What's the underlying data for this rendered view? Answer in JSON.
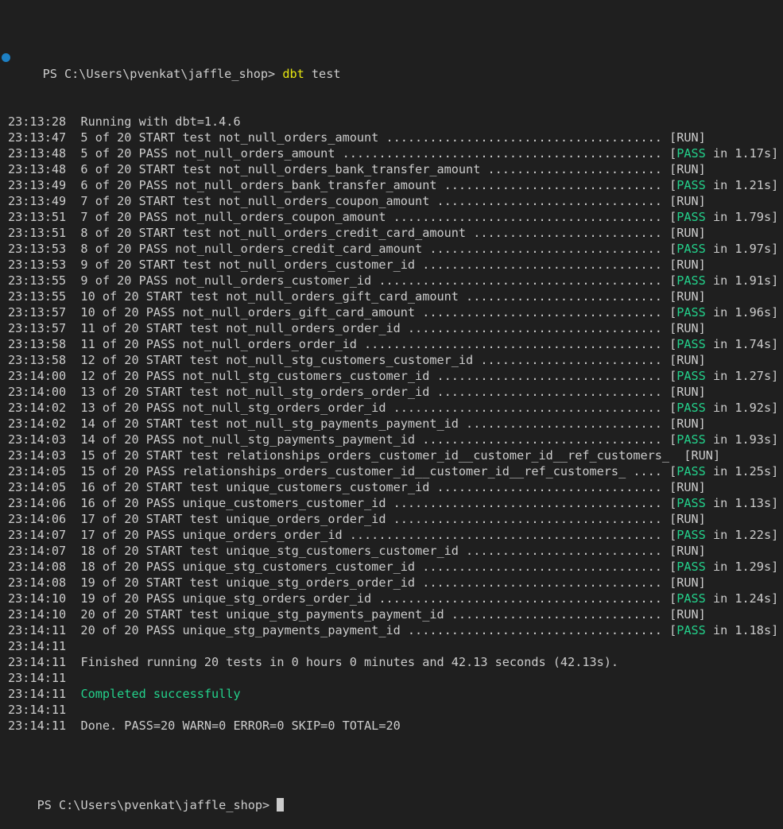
{
  "colors": {
    "bg": "#1f1f1f",
    "fg": "#cccccc",
    "green": "#23d18b",
    "yellow": "#e5e510",
    "dot": "#1d80c4",
    "cursor": "#cccccc"
  },
  "prompt": {
    "text": "PS C:\\Users\\pvenkat\\jaffle_shop> ",
    "command": "dbt",
    "args": " test"
  },
  "log_lines": [
    {
      "ts": "23:13:28",
      "msg": "Running with dbt=1.4.6"
    },
    {
      "ts": "23:13:47",
      "idx": "5 of 20",
      "verb": "START test",
      "name": "not_null_orders_amount",
      "dots": 38,
      "status": "RUN"
    },
    {
      "ts": "23:13:48",
      "idx": "5 of 20",
      "verb": "PASS",
      "name": "not_null_orders_amount",
      "dots": 44,
      "status": "PASS",
      "dur": "1.17s"
    },
    {
      "ts": "23:13:48",
      "idx": "6 of 20",
      "verb": "START test",
      "name": "not_null_orders_bank_transfer_amount",
      "dots": 24,
      "status": "RUN"
    },
    {
      "ts": "23:13:49",
      "idx": "6 of 20",
      "verb": "PASS",
      "name": "not_null_orders_bank_transfer_amount",
      "dots": 30,
      "status": "PASS",
      "dur": "1.21s"
    },
    {
      "ts": "23:13:49",
      "idx": "7 of 20",
      "verb": "START test",
      "name": "not_null_orders_coupon_amount",
      "dots": 31,
      "status": "RUN"
    },
    {
      "ts": "23:13:51",
      "idx": "7 of 20",
      "verb": "PASS",
      "name": "not_null_orders_coupon_amount",
      "dots": 37,
      "status": "PASS",
      "dur": "1.79s"
    },
    {
      "ts": "23:13:51",
      "idx": "8 of 20",
      "verb": "START test",
      "name": "not_null_orders_credit_card_amount",
      "dots": 26,
      "status": "RUN"
    },
    {
      "ts": "23:13:53",
      "idx": "8 of 20",
      "verb": "PASS",
      "name": "not_null_orders_credit_card_amount",
      "dots": 32,
      "status": "PASS",
      "dur": "1.97s"
    },
    {
      "ts": "23:13:53",
      "idx": "9 of 20",
      "verb": "START test",
      "name": "not_null_orders_customer_id",
      "dots": 33,
      "status": "RUN"
    },
    {
      "ts": "23:13:55",
      "idx": "9 of 20",
      "verb": "PASS",
      "name": "not_null_orders_customer_id",
      "dots": 39,
      "status": "PASS",
      "dur": "1.91s"
    },
    {
      "ts": "23:13:55",
      "idx": "10 of 20",
      "verb": "START test",
      "name": "not_null_orders_gift_card_amount",
      "dots": 27,
      "status": "RUN"
    },
    {
      "ts": "23:13:57",
      "idx": "10 of 20",
      "verb": "PASS",
      "name": "not_null_orders_gift_card_amount",
      "dots": 33,
      "status": "PASS",
      "dur": "1.96s"
    },
    {
      "ts": "23:13:57",
      "idx": "11 of 20",
      "verb": "START test",
      "name": "not_null_orders_order_id",
      "dots": 35,
      "status": "RUN"
    },
    {
      "ts": "23:13:58",
      "idx": "11 of 20",
      "verb": "PASS",
      "name": "not_null_orders_order_id",
      "dots": 41,
      "status": "PASS",
      "dur": "1.74s"
    },
    {
      "ts": "23:13:58",
      "idx": "12 of 20",
      "verb": "START test",
      "name": "not_null_stg_customers_customer_id",
      "dots": 25,
      "status": "RUN"
    },
    {
      "ts": "23:14:00",
      "idx": "12 of 20",
      "verb": "PASS",
      "name": "not_null_stg_customers_customer_id",
      "dots": 31,
      "status": "PASS",
      "dur": "1.27s"
    },
    {
      "ts": "23:14:00",
      "idx": "13 of 20",
      "verb": "START test",
      "name": "not_null_stg_orders_order_id",
      "dots": 31,
      "status": "RUN"
    },
    {
      "ts": "23:14:02",
      "idx": "13 of 20",
      "verb": "PASS",
      "name": "not_null_stg_orders_order_id",
      "dots": 37,
      "status": "PASS",
      "dur": "1.92s"
    },
    {
      "ts": "23:14:02",
      "idx": "14 of 20",
      "verb": "START test",
      "name": "not_null_stg_payments_payment_id",
      "dots": 27,
      "status": "RUN"
    },
    {
      "ts": "23:14:03",
      "idx": "14 of 20",
      "verb": "PASS",
      "name": "not_null_stg_payments_payment_id",
      "dots": 33,
      "status": "PASS",
      "dur": "1.93s"
    },
    {
      "ts": "23:14:03",
      "idx": "15 of 20",
      "verb": "START test",
      "name": "relationships_orders_customer_id__customer_id__ref_customers_",
      "dots": 0,
      "status": "RUN"
    },
    {
      "ts": "23:14:05",
      "idx": "15 of 20",
      "verb": "PASS",
      "name": "relationships_orders_customer_id__customer_id__ref_customers_",
      "dots": 4,
      "status": "PASS",
      "dur": "1.25s"
    },
    {
      "ts": "23:14:05",
      "idx": "16 of 20",
      "verb": "START test",
      "name": "unique_customers_customer_id",
      "dots": 31,
      "status": "RUN"
    },
    {
      "ts": "23:14:06",
      "idx": "16 of 20",
      "verb": "PASS",
      "name": "unique_customers_customer_id",
      "dots": 37,
      "status": "PASS",
      "dur": "1.13s"
    },
    {
      "ts": "23:14:06",
      "idx": "17 of 20",
      "verb": "START test",
      "name": "unique_orders_order_id",
      "dots": 37,
      "status": "RUN"
    },
    {
      "ts": "23:14:07",
      "idx": "17 of 20",
      "verb": "PASS",
      "name": "unique_orders_order_id",
      "dots": 43,
      "status": "PASS",
      "dur": "1.22s"
    },
    {
      "ts": "23:14:07",
      "idx": "18 of 20",
      "verb": "START test",
      "name": "unique_stg_customers_customer_id",
      "dots": 27,
      "status": "RUN"
    },
    {
      "ts": "23:14:08",
      "idx": "18 of 20",
      "verb": "PASS",
      "name": "unique_stg_customers_customer_id",
      "dots": 33,
      "status": "PASS",
      "dur": "1.29s"
    },
    {
      "ts": "23:14:08",
      "idx": "19 of 20",
      "verb": "START test",
      "name": "unique_stg_orders_order_id",
      "dots": 33,
      "status": "RUN"
    },
    {
      "ts": "23:14:10",
      "idx": "19 of 20",
      "verb": "PASS",
      "name": "unique_stg_orders_order_id",
      "dots": 39,
      "status": "PASS",
      "dur": "1.24s"
    },
    {
      "ts": "23:14:10",
      "idx": "20 of 20",
      "verb": "START test",
      "name": "unique_stg_payments_payment_id",
      "dots": 29,
      "status": "RUN"
    },
    {
      "ts": "23:14:11",
      "idx": "20 of 20",
      "verb": "PASS",
      "name": "unique_stg_payments_payment_id",
      "dots": 35,
      "status": "PASS",
      "dur": "1.18s"
    },
    {
      "ts": "23:14:11",
      "msg": ""
    },
    {
      "ts": "23:14:11",
      "msg": "Finished running 20 tests in 0 hours 0 minutes and 42.13 seconds (42.13s)."
    },
    {
      "ts": "23:14:11",
      "msg": ""
    },
    {
      "ts": "23:14:11",
      "msg": "Completed successfully",
      "msg_color": "green"
    },
    {
      "ts": "23:14:11",
      "msg": ""
    },
    {
      "ts": "23:14:11",
      "msg": "Done. PASS=20 WARN=0 ERROR=0 SKIP=0 TOTAL=20"
    }
  ],
  "final_prompt": {
    "text": "PS C:\\Users\\pvenkat\\jaffle_shop> "
  }
}
